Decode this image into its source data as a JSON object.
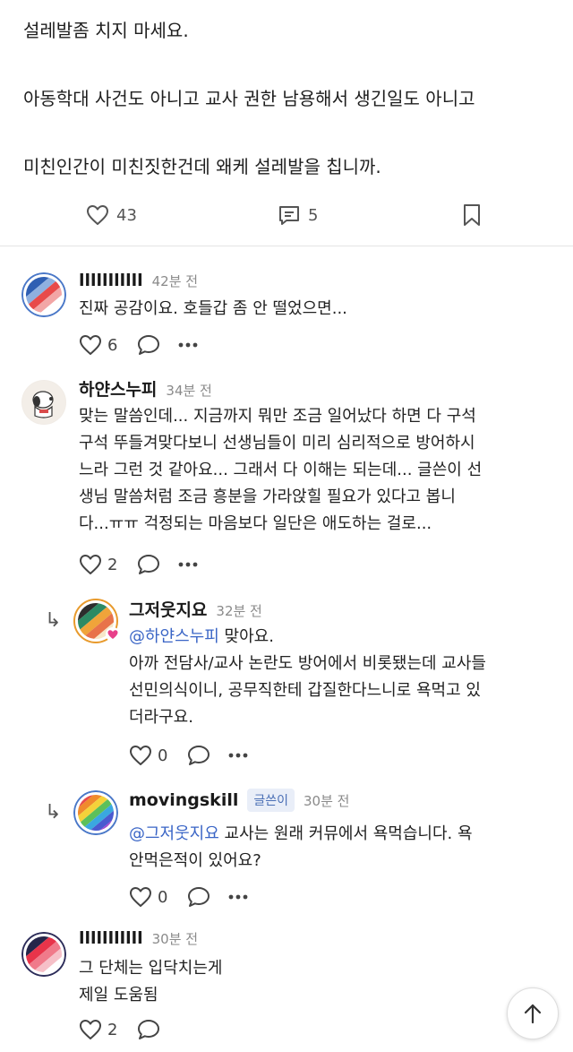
{
  "post": {
    "lines": [
      "설레발좀 치지 마세요.",
      "아동학대 사건도 아니고 교사 권한 남용해서 생긴일도 아니고",
      "미친인간이 미친짓한건데 왜케 설레발을 칩니까."
    ],
    "like_count": "43",
    "comment_count": "5"
  },
  "comments": [
    {
      "author": "lllllllllll",
      "time": "42분 전",
      "lines": [
        "진짜 공감이요. 호들갑 좀 안 떨었으면..."
      ],
      "like_count": "6"
    },
    {
      "author": "하얀스누피",
      "time": "34분 전",
      "lines": [
        "맞는 말씀인데... 지금까지 뭐만 조금 일어났다 하면 다 구석",
        "구석 뚜들겨맞다보니 선생님들이 미리 심리적으로 방어하시",
        "느라 그런 것 같아요... 그래서 다 이해는 되는데... 글쓴이 선",
        "생님 말씀처럼 조금 흥분을 가라앉힐 필요가 있다고 봅니",
        "다...ㅠㅠ 걱정되는 마음보다 일단은 애도하는 걸로..."
      ],
      "like_count": "2"
    },
    {
      "author": "그저웃지요",
      "time": "32분 전",
      "mention": "@하얀스누피",
      "first_line_rest": " 맞아요.",
      "lines": [
        "아까 전담사/교사 논란도 방어에서 비롯됐는데 교사들",
        "선민의식이니, 공무직한테 갑질한다느니로 욕먹고 있",
        "더라구요."
      ],
      "like_count": "0"
    },
    {
      "author": "movingskill",
      "badge": "글쓴이",
      "time": "30분 전",
      "mention": "@그저웃지요",
      "first_line_rest": " 교사는 원래 커뮤에서 욕먹습니다. 욕",
      "lines": [
        "안먹은적이 있어요?"
      ],
      "like_count": "0"
    },
    {
      "author": "lllllllllll",
      "time": "30분 전",
      "lines": [
        "그 단체는 입닥치는게",
        "제일 도움됨"
      ],
      "like_count": "2"
    }
  ],
  "icons": {
    "like": "heart-icon",
    "comment": "comment-icon",
    "bookmark": "bookmark-icon",
    "more": "more-icon",
    "reply": "reply-arrow-icon",
    "scroll_top": "arrow-up-icon"
  },
  "colors": {
    "mention": "#3a65c6",
    "badge_bg": "#e9eef8",
    "time": "#8a8a8a"
  }
}
